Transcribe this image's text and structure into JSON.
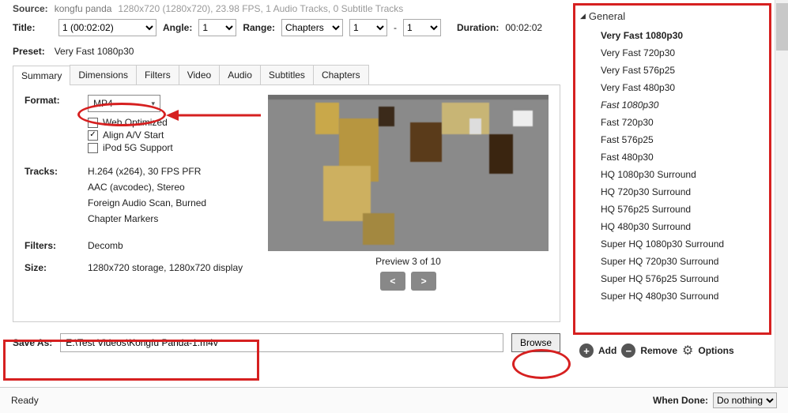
{
  "source": {
    "label": "Source:",
    "name": "kongfu panda",
    "meta": "1280x720 (1280x720), 23.98 FPS, 1 Audio Tracks, 0 Subtitle Tracks"
  },
  "title": {
    "label": "Title:",
    "selected": "1 (00:02:02)"
  },
  "angle": {
    "label": "Angle:",
    "selected": "1"
  },
  "range": {
    "label": "Range:",
    "type": "Chapters",
    "from": "1",
    "dash": "-",
    "to": "1"
  },
  "duration": {
    "label": "Duration:",
    "value": "00:02:02"
  },
  "preset_row": {
    "label": "Preset:",
    "value": "Very Fast 1080p30"
  },
  "tabs": [
    "Summary",
    "Dimensions",
    "Filters",
    "Video",
    "Audio",
    "Subtitles",
    "Chapters"
  ],
  "format": {
    "label": "Format:",
    "value": "MP4",
    "opts": [
      {
        "label": "Web Optimized",
        "checked": false
      },
      {
        "label": "Align A/V Start",
        "checked": true
      },
      {
        "label": "iPod 5G Support",
        "checked": false
      }
    ]
  },
  "tracks": {
    "label": "Tracks:",
    "items": [
      "H.264 (x264), 30 FPS PFR",
      "AAC (avcodec), Stereo",
      "Foreign Audio Scan, Burned",
      "Chapter Markers"
    ]
  },
  "filters": {
    "label": "Filters:",
    "value": "Decomb"
  },
  "size": {
    "label": "Size:",
    "value": "1280x720 storage, 1280x720 display"
  },
  "preview": {
    "text": "Preview 3 of 10",
    "prev": "<",
    "next": ">"
  },
  "save": {
    "label": "Save As:",
    "value": "E:\\Test Videos\\Kongfu Panda-1.m4v",
    "browse": "Browse"
  },
  "status": {
    "ready": "Ready"
  },
  "right": {
    "header": "General",
    "items": [
      {
        "label": "Very Fast 1080p30",
        "bold": true
      },
      {
        "label": "Very Fast 720p30"
      },
      {
        "label": "Very Fast 576p25"
      },
      {
        "label": "Very Fast 480p30"
      },
      {
        "label": "Fast 1080p30",
        "italic": true
      },
      {
        "label": "Fast 720p30"
      },
      {
        "label": "Fast 576p25"
      },
      {
        "label": "Fast 480p30"
      },
      {
        "label": "HQ 1080p30 Surround"
      },
      {
        "label": "HQ 720p30 Surround"
      },
      {
        "label": "HQ 576p25 Surround"
      },
      {
        "label": "HQ 480p30 Surround"
      },
      {
        "label": "Super HQ 1080p30 Surround"
      },
      {
        "label": "Super HQ 720p30 Surround"
      },
      {
        "label": "Super HQ 576p25 Surround"
      },
      {
        "label": "Super HQ 480p30 Surround"
      }
    ],
    "toolbar": {
      "add": "Add",
      "remove": "Remove",
      "options": "Options"
    }
  },
  "when_done": {
    "label": "When Done:",
    "value": "Do nothing"
  }
}
